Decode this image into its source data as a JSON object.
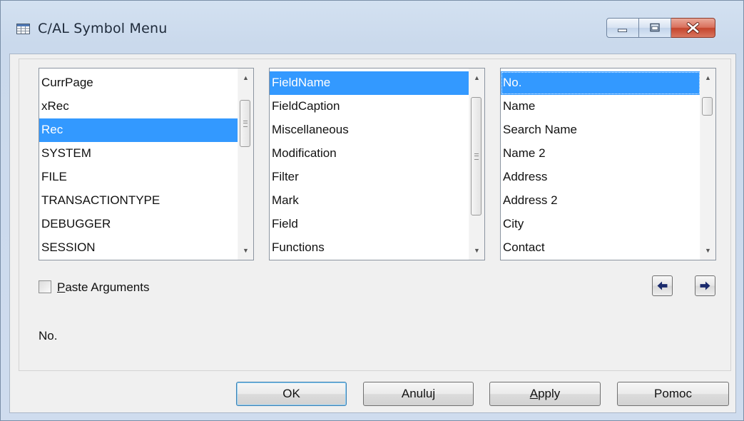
{
  "window": {
    "title": "C/AL Symbol Menu"
  },
  "lists": {
    "left": {
      "items": [
        "CurrPage",
        "xRec",
        "Rec",
        "SYSTEM",
        "FILE",
        "TRANSACTIONTYPE",
        "DEBUGGER",
        "SESSION"
      ],
      "selected": "Rec"
    },
    "middle": {
      "items": [
        "FieldName",
        "FieldCaption",
        "Miscellaneous",
        "Modification",
        "Filter",
        "Mark",
        "Field",
        "Functions"
      ],
      "selected": "FieldName"
    },
    "right": {
      "items": [
        "No.",
        "Name",
        "Search Name",
        "Name 2",
        "Address",
        "Address 2",
        "City",
        "Contact"
      ],
      "selected": "No."
    }
  },
  "paste_arguments": {
    "label_hotkey": "P",
    "label_rest": "aste Arguments",
    "checked": false
  },
  "status_text": "No.",
  "buttons": {
    "ok": "OK",
    "cancel": "Anuluj",
    "apply_hotkey": "A",
    "apply_rest": "pply",
    "help": "Pomoc"
  },
  "colors": {
    "selection": "#3399ff",
    "close_button": "#c4452d"
  }
}
